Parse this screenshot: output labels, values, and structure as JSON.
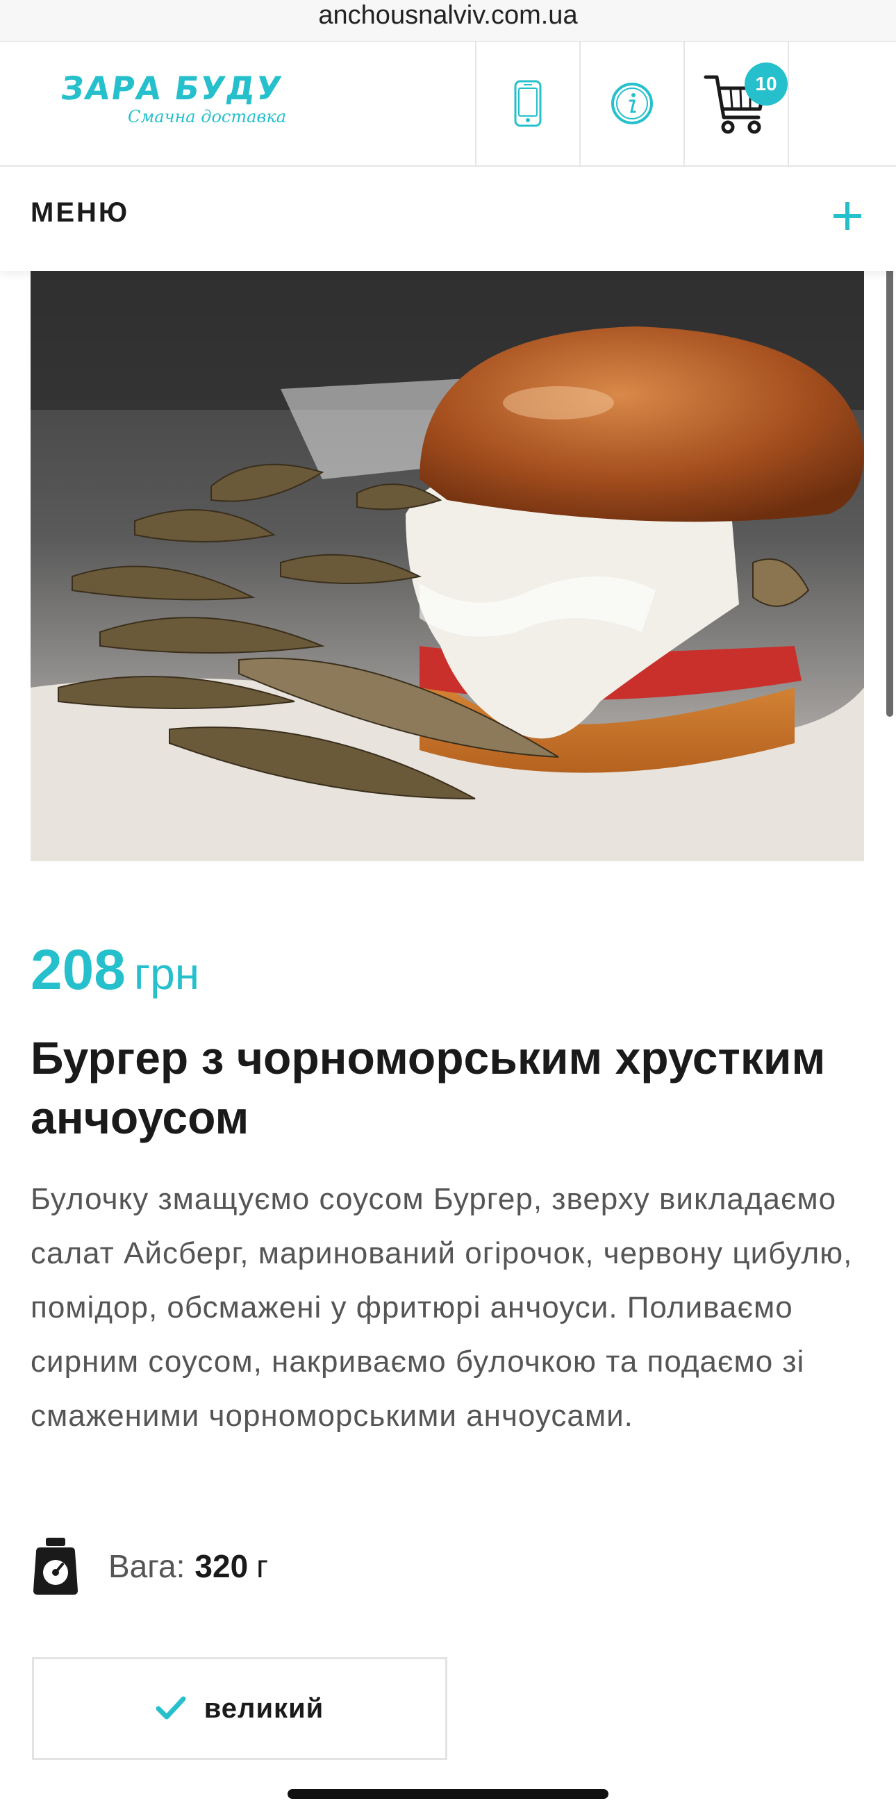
{
  "browser": {
    "url": "anchousnalviv.com.ua"
  },
  "header": {
    "logo_text": "ЗАРА БУДУ",
    "logo_tagline": "Смачна доставка",
    "phone_icon": "phone-icon",
    "info_icon": "info-icon",
    "cart_icon": "cart-icon",
    "cart_count": "10"
  },
  "menu": {
    "label": "МЕНЮ",
    "expand_icon": "plus-icon"
  },
  "product": {
    "image_alt": "burger-with-fried-anchovies",
    "price_value": "208",
    "price_currency": "грн",
    "title": "Бургер з чорноморським хрустким анчоусом",
    "description": "Булочку змащуємо соусом Бургер, зверху викладаємо салат Айсберг, маринований огірочок, червону цибулю, помідор, обсмажені у фритюрі анчоуси. Поливаємо сирним соусом, накриваємо булочкою та подаємо зі смаженими чорноморськими анчоусами.",
    "weight_label": "Вага:",
    "weight_value": "320",
    "weight_unit": "г",
    "size_option": {
      "label": "великий",
      "selected": true
    }
  },
  "colors": {
    "accent": "#25c0cc",
    "text": "#1a1a1a",
    "muted": "#555555",
    "border": "#e3e3e3"
  }
}
